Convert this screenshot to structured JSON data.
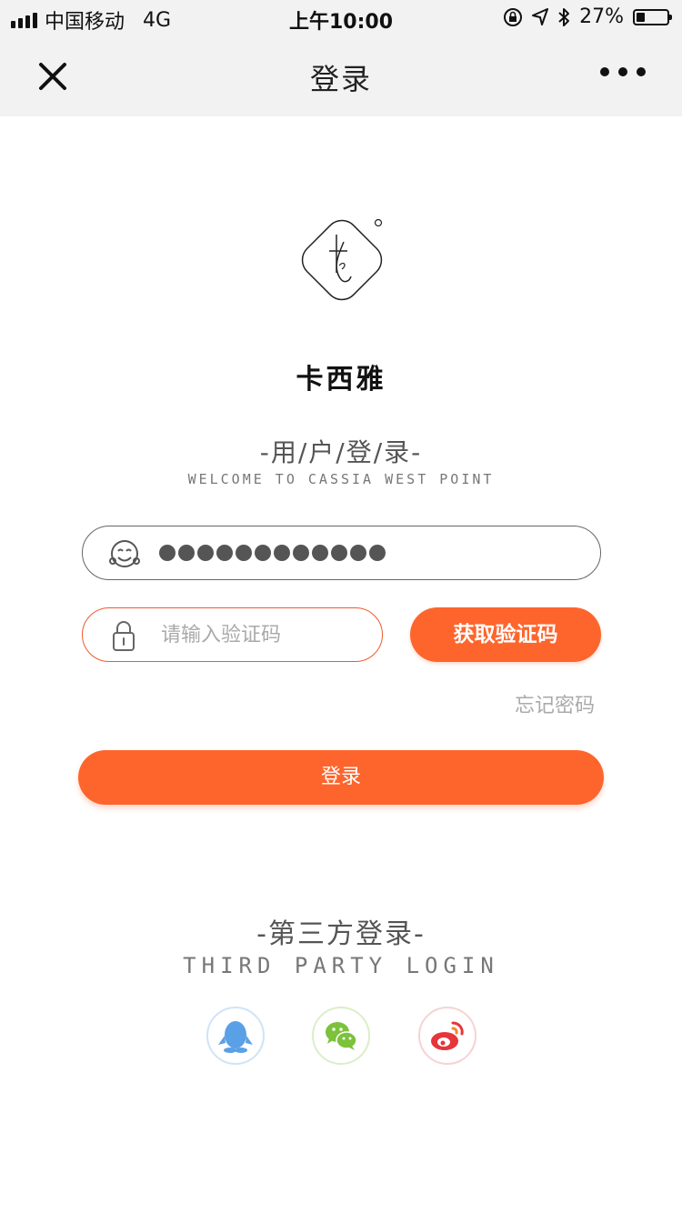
{
  "status_bar": {
    "carrier": "中国移动",
    "network": "4G",
    "time": "上午10:00",
    "battery_percent": "27%",
    "battery_level": 0.27
  },
  "nav": {
    "title": "登录",
    "close_icon": "close-icon",
    "more_icon": "more-icon"
  },
  "brand": {
    "name": "卡西雅"
  },
  "login_section": {
    "title": "-用/户/登/录-",
    "subtitle": "WELCOME TO CASSIA WEST POINT"
  },
  "form": {
    "username_dots": 12,
    "code_placeholder": "请输入验证码",
    "code_value": "",
    "get_code_label": "获取验证码",
    "forgot_label": "忘记密码",
    "login_label": "登录"
  },
  "third_party": {
    "title": "-第三方登录-",
    "subtitle": "THIRD PARTY LOGIN",
    "providers": [
      "qq-icon",
      "wechat-icon",
      "weibo-icon"
    ]
  },
  "colors": {
    "accent": "#fd652d",
    "input_border_active": "#f05a28",
    "qq": "#5aa0e6",
    "wechat": "#7cc23a",
    "weibo": "#e6363b"
  }
}
